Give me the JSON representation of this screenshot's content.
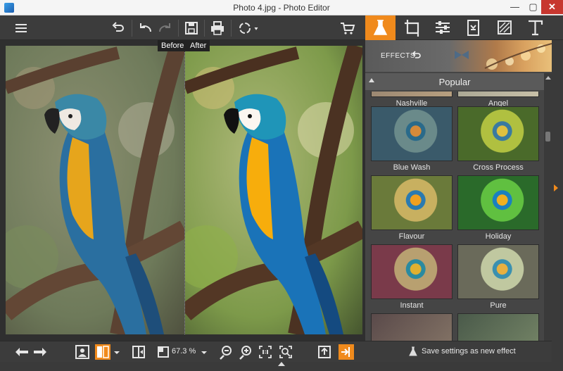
{
  "window": {
    "title": "Photo 4.jpg - Photo Editor",
    "minimize": "—",
    "maximize": "▢",
    "close": "✕"
  },
  "toolbar": {
    "menu_icon": "hamburger-icon",
    "rotate_icon": "rotate-left-icon",
    "undo_icon": "undo-icon",
    "redo_icon": "redo-icon",
    "save_icon": "save-icon",
    "print_icon": "print-icon",
    "share_icon": "share-icon",
    "cart_icon": "cart-icon"
  },
  "tabs": [
    "effects",
    "crop",
    "adjust",
    "retouch",
    "frames",
    "text"
  ],
  "canvas": {
    "before_label": "Before",
    "after_label": "After"
  },
  "bottombar": {
    "zoom": "67.3 %"
  },
  "effects": {
    "header": "EFFECTS",
    "section": "Popular",
    "save_label": "Save settings as new effect",
    "items": [
      {
        "label": "Nashville"
      },
      {
        "label": "Angel"
      },
      {
        "label": "Blue Wash"
      },
      {
        "label": "Cross Process"
      },
      {
        "label": "Flavour"
      },
      {
        "label": "Holiday"
      },
      {
        "label": "Instant"
      },
      {
        "label": "Pure"
      }
    ]
  },
  "colors": {
    "accent": "#f08a1c",
    "panel": "#454545",
    "toolbar": "#3c3c3c"
  }
}
